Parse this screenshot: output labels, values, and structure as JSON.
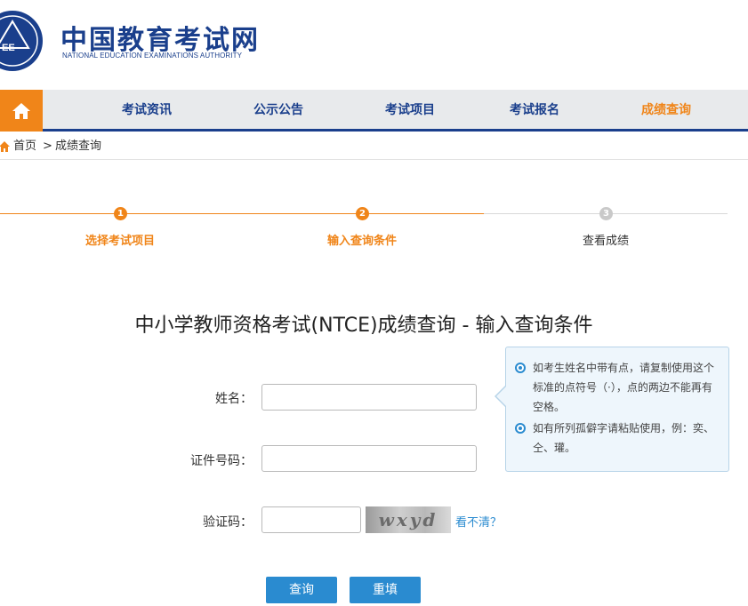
{
  "site": {
    "name_cn": "中国教育考试网",
    "name_en": "NATIONAL EDUCATION EXAMINATIONS AUTHORITY",
    "seal_text": "NEEA"
  },
  "nav": {
    "items": [
      {
        "label": "考试资讯"
      },
      {
        "label": "公示公告"
      },
      {
        "label": "考试项目"
      },
      {
        "label": "考试报名"
      },
      {
        "label": "成绩查询",
        "active": true
      }
    ]
  },
  "breadcrumb": {
    "home": "首页",
    "separator": ">",
    "current": "成绩查询"
  },
  "steps": [
    {
      "num": "1",
      "label": "选择考试项目",
      "state": "done"
    },
    {
      "num": "2",
      "label": "输入查询条件",
      "state": "done"
    },
    {
      "num": "3",
      "label": "查看成绩",
      "state": "todo"
    }
  ],
  "title": "中小学教师资格考试(NTCE)成绩查询 - 输入查询条件",
  "form": {
    "name_label": "姓名：",
    "name_value": "",
    "id_label": "证件号码：",
    "id_value": "",
    "captcha_label": "验证码：",
    "captcha_value": "",
    "captcha_image_text": "wxyd",
    "captcha_refresh": "看不清？"
  },
  "tips": [
    "如考生姓名中带有点，请复制使用这个标准的点符号（·），点的两边不能再有空格。",
    "如有所列孤僻字请粘贴使用，例：奕、仝、瓘。"
  ],
  "buttons": {
    "submit": "查询",
    "reset": "重填"
  },
  "colors": {
    "brand_blue": "#1a3f8c",
    "accent_orange": "#f08519",
    "button_blue": "#2a8bd0"
  }
}
